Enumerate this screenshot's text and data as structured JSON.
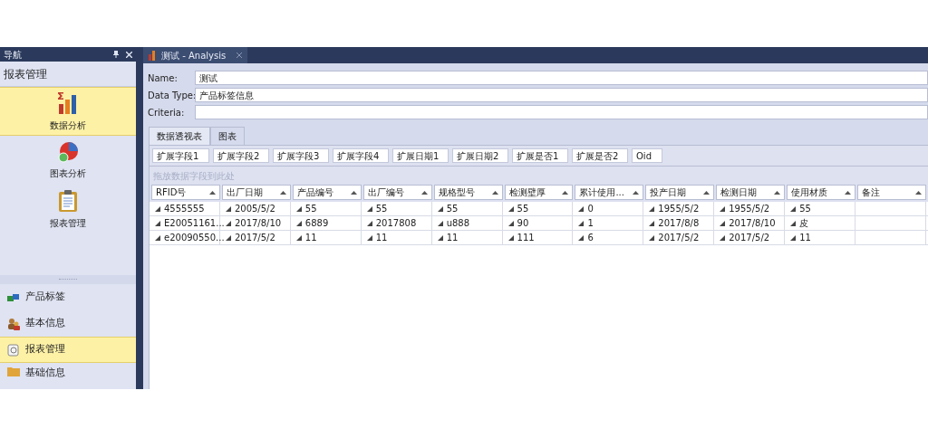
{
  "nav": {
    "title": "导航",
    "pane_title": "报表管理",
    "large_items": [
      {
        "label": "数据分析",
        "selected": true
      },
      {
        "label": "图表分析",
        "selected": false
      },
      {
        "label": "报表管理",
        "selected": false
      }
    ],
    "items": [
      {
        "label": "产品标签",
        "selected": false
      },
      {
        "label": "基本信息",
        "selected": false
      },
      {
        "label": "报表管理",
        "selected": true
      },
      {
        "label": "基础信息",
        "selected": false
      }
    ]
  },
  "document_tab": {
    "title": "测试 - Analysis"
  },
  "form": [
    {
      "label": "Name:",
      "value": "测试"
    },
    {
      "label": "Data Type:",
      "value": "产品标签信息"
    },
    {
      "label": "Criteria:"
    }
  ],
  "tabs": [
    {
      "label": "数据透视表",
      "selected": true
    },
    {
      "label": "图表",
      "selected": false
    }
  ],
  "field_chips": [
    "扩展字段1",
    "扩展字段2",
    "扩展字段3",
    "扩展字段4",
    "扩展日期1",
    "扩展日期2",
    "扩展是否1",
    "扩展是否2",
    "Oid"
  ],
  "drop_hint": "拖放数据字段到此处",
  "columns": [
    "RFID号",
    "出厂日期",
    "产品编号",
    "出厂编号",
    "规格型号",
    "检测壁厚",
    "累计使用...",
    "投产日期",
    "检测日期",
    "使用材质",
    "备注"
  ],
  "rows": [
    [
      "4555555",
      "2005/5/2",
      "55",
      "55",
      "55",
      "55",
      "0",
      "1955/5/2",
      "1955/5/2",
      "55"
    ],
    [
      "E20051161...",
      "2017/8/10",
      "6889",
      "2017808",
      "u888",
      "90",
      "1",
      "2017/8/8",
      "2017/8/10",
      "皮"
    ],
    [
      "e20090550...",
      "2017/5/2",
      "11",
      "11",
      "11",
      "111",
      "6",
      "2017/5/2",
      "2017/5/2",
      "11"
    ]
  ]
}
